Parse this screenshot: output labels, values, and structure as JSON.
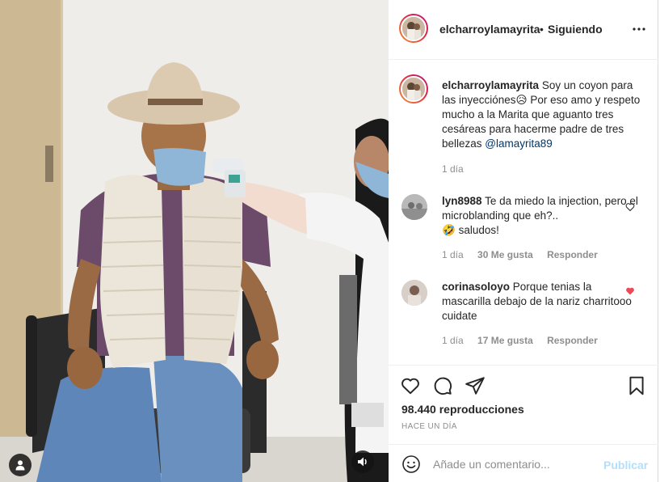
{
  "post": {
    "author": "elcharroylamayrita",
    "separator": "•",
    "follow_status": "Siguiendo",
    "caption": {
      "username": "elcharroylamayrita",
      "text_1": "Soy un coyon para las inyecciónes",
      "emoji_1": "😥",
      "text_2": "Por eso amo y respeto mucho a la Marita que aguanto tres cesáreas para hacerme padre de tres bellezas",
      "mention": "@lamayrita89",
      "time": "1 día"
    },
    "comments": [
      {
        "username": "lyn8988",
        "text_1": "Te da miedo la injection, pero el microblanding que eh?..",
        "emoji": "🤣",
        "text_2": "saludos!",
        "time": "1 día",
        "likes": "30 Me gusta",
        "reply": "Responder",
        "liked": false
      },
      {
        "username": "corinasoloyo",
        "text_1": "Porque tenias la mascarilla debajo de la nariz charritooo cuidate",
        "time": "1 día",
        "likes": "17 Me gusta",
        "reply": "Responder",
        "liked": true
      }
    ],
    "views": "98.440 reproducciones",
    "age": "HACE UN DÍA"
  },
  "composer": {
    "placeholder": "Añade un comentario...",
    "post_label": "Publicar"
  },
  "icons": {
    "like": "heart-icon",
    "comment": "comment-icon",
    "share": "paper-plane-icon",
    "save": "bookmark-icon",
    "more": "more-options-icon",
    "emoji": "emoji-icon",
    "sound": "speaker-icon",
    "tag": "user-tag-icon"
  },
  "colors": {
    "liked_heart": "#ed4956",
    "mention": "#00376b",
    "post_button_disabled": "#b2dffc",
    "secondary_text": "#8e8e8e"
  }
}
